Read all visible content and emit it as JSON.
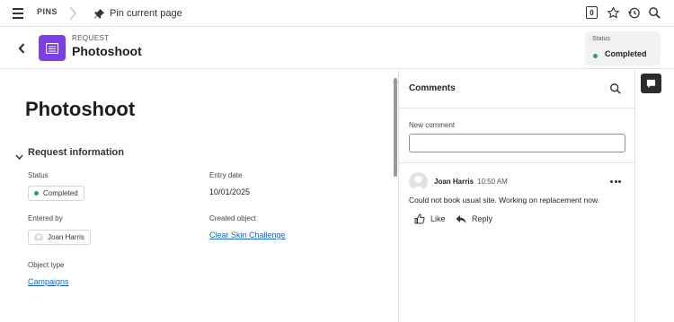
{
  "topbar": {
    "pins_label": "PINS",
    "pin_page_label": "Pin current page",
    "notification_count": "0"
  },
  "header": {
    "object_type": "REQUEST",
    "title": "Photoshoot",
    "status_label": "Status",
    "status_value": "Completed"
  },
  "main": {
    "page_title": "Photoshoot",
    "section_title": "Request information",
    "fields": {
      "status": {
        "label": "Status",
        "value": "Completed"
      },
      "entry_date": {
        "label": "Entry date",
        "value": "10/01/2025"
      },
      "entered_by": {
        "label": "Entered by",
        "value": "Joan Harris"
      },
      "created_object": {
        "label": "Created object",
        "value": "Clear Skin Challenge"
      },
      "object_type": {
        "label": "Object type",
        "value": "Campaigns"
      }
    }
  },
  "comments": {
    "title": "Comments",
    "new_comment_label": "New comment",
    "new_comment_value": "",
    "items": [
      {
        "author": "Joan Harris",
        "time": "10:50 AM",
        "text": "Could not book usual site. Working on replacement now.",
        "like_label": "Like",
        "reply_label": "Reply"
      }
    ]
  },
  "icons": {
    "menu": "hamburger-menu-icon",
    "breadcrumb": "chevron-right-icon",
    "pin": "pin-icon",
    "favorite": "star-icon",
    "recent": "history-icon",
    "search": "search-icon",
    "back": "chevron-left-icon",
    "request": "request-icon",
    "collapse": "chevron-down-icon",
    "more": "more-horizontal-icon",
    "like": "thumbs-up-icon",
    "reply": "reply-icon",
    "comments_toggle": "comment-icon"
  },
  "colors": {
    "accent_purple": "#7b3fe4",
    "status_green": "#2d9d78",
    "link_blue": "#1a63c9"
  }
}
